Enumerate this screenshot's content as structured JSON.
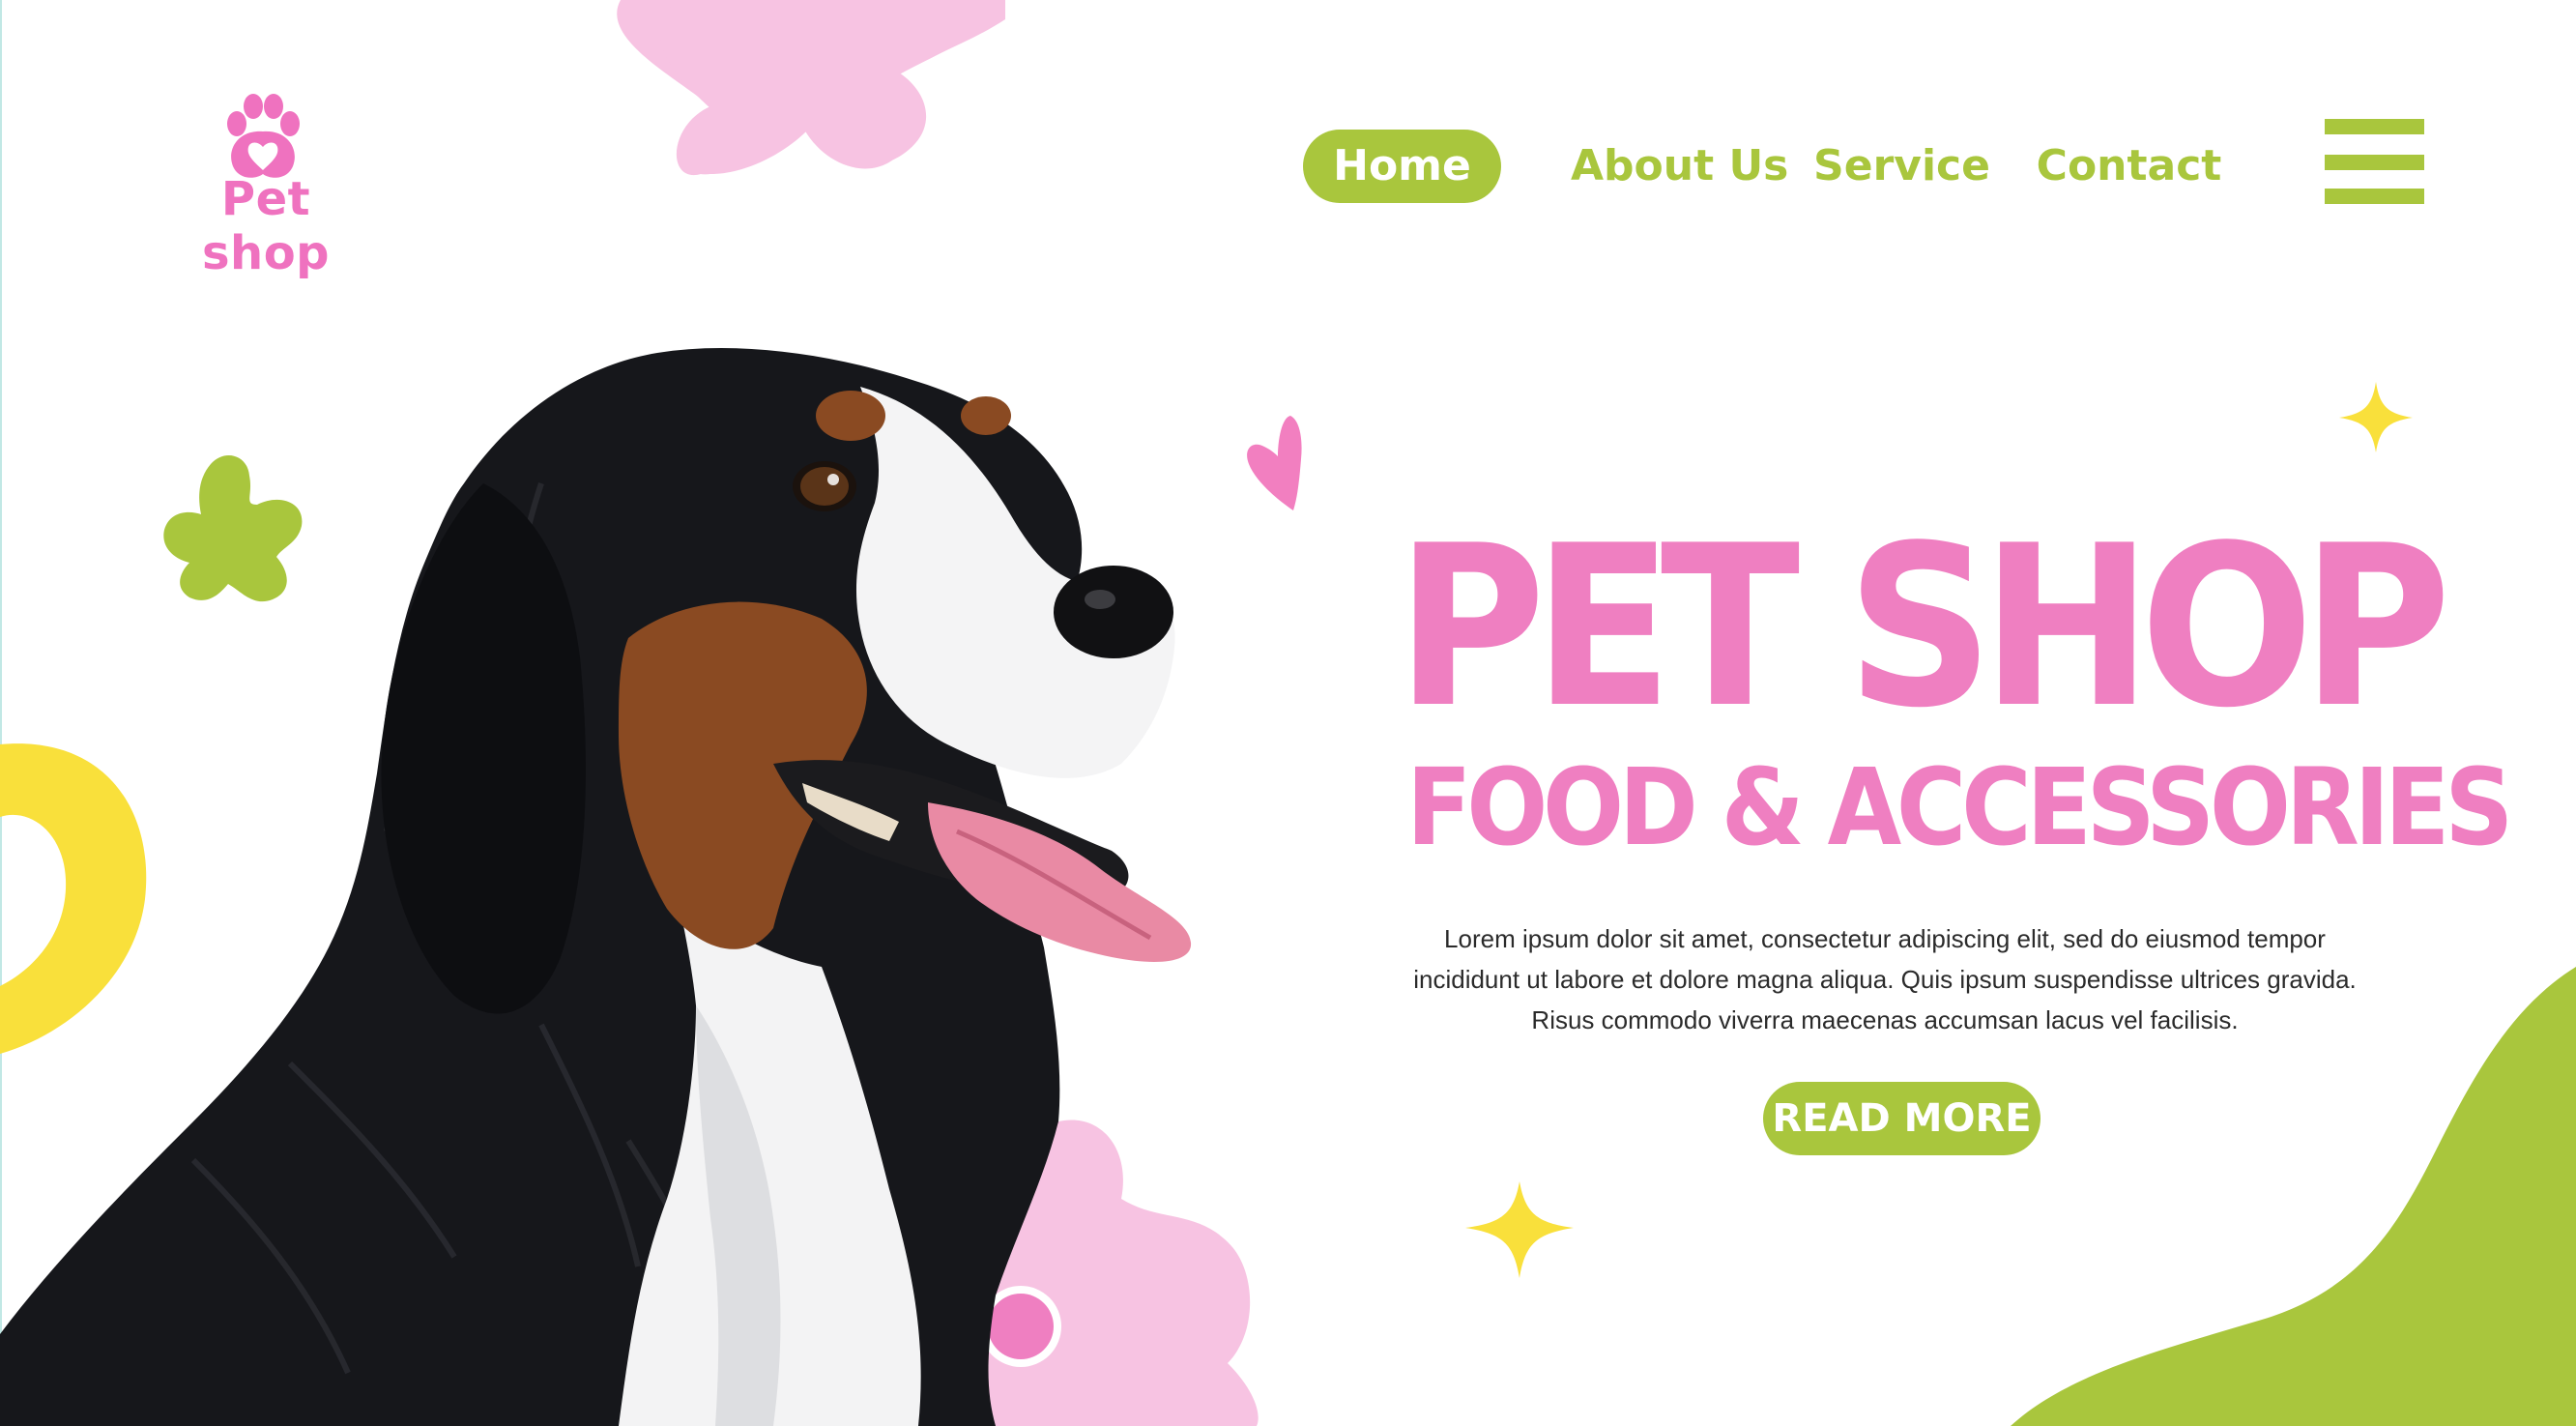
{
  "brand": {
    "name": "Pet shop",
    "icon": "paw-heart-icon"
  },
  "nav": {
    "items": [
      {
        "label": "Home",
        "active": true
      },
      {
        "label": "About Us",
        "active": false
      },
      {
        "label": "Service",
        "active": false
      },
      {
        "label": "Contact",
        "active": false
      }
    ],
    "menu_icon": "hamburger-menu-icon"
  },
  "hero": {
    "title": "PET SHOP",
    "subtitle": "FOOD & ACCESSORIES",
    "description": "Lorem ipsum dolor sit amet, consectetur  adipiscing elit, sed do eiusmod tempor incididunt ut labore et dolore magna aliqua. Quis ipsum suspendisse ultrices gravida. Risus commodo viverra maecenas accumsan lacus vel facilisis.",
    "cta_label": "READ MORE",
    "image": "bernese-mountain-dog"
  },
  "colors": {
    "pink": "#ef7fc1",
    "light_pink": "#f7c3e2",
    "green": "#a9c63d",
    "yellow": "#f9e03b",
    "white": "#ffffff",
    "text_dark": "#2b2b2b"
  }
}
